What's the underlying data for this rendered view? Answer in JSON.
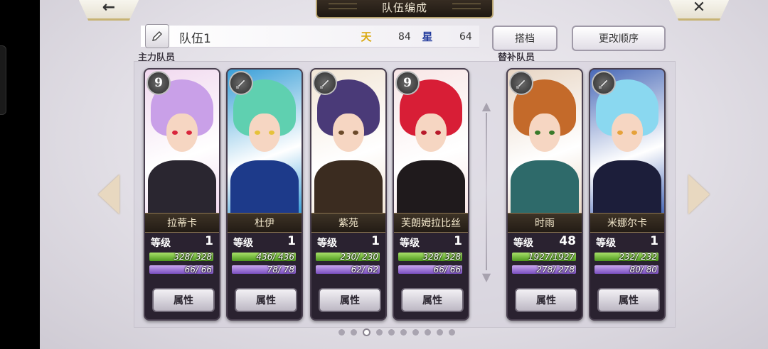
{
  "header": {
    "back_icon": "←",
    "title": "队伍编成",
    "close_icon": "✕"
  },
  "team": {
    "name": "队伍1",
    "stat1_icon": "天",
    "stat1_value": "84",
    "stat2_icon": "星",
    "stat2_value": "64"
  },
  "buttons": {
    "partner": "搭档",
    "reorder": "更改顺序"
  },
  "sections": {
    "main": "主力队员",
    "sub": "替补队员"
  },
  "labels": {
    "level": "等级",
    "attr": "属性"
  },
  "members": [
    {
      "name": "拉蒂卡",
      "badge": "9",
      "level": "1",
      "hp": "328/ 328",
      "mp": "66/ 66",
      "colors": {
        "bg": "#f1d9ef",
        "hair": "#c9a0e8",
        "body": "#2a2630",
        "eye": "#d9263c"
      }
    },
    {
      "name": "杜伊",
      "badge": "",
      "level": "1",
      "hp": "436/ 436",
      "mp": "78/ 78",
      "colors": {
        "bg": "#3a9fd8",
        "hair": "#5fd0b0",
        "body": "#1d3a8a",
        "eye": "#e6c23a"
      }
    },
    {
      "name": "紫苑",
      "badge": "",
      "level": "1",
      "hp": "230/ 230",
      "mp": "62/ 62",
      "colors": {
        "bg": "#f2e6d6",
        "hair": "#4a3a78",
        "body": "#3b2c20",
        "eye": "#6b4a2a"
      }
    },
    {
      "name": "芙朗姆拉比丝",
      "badge": "9",
      "level": "1",
      "hp": "328/ 328",
      "mp": "66/ 66",
      "colors": {
        "bg": "#f8e6e6",
        "hair": "#d81e36",
        "body": "#1f1a1c",
        "eye": "#b81a2a"
      }
    }
  ],
  "substitutes": [
    {
      "name": "时雨",
      "badge": "",
      "level": "48",
      "hp": "1927/1927",
      "mp": "278/ 278",
      "colors": {
        "bg": "#e8d6c4",
        "hair": "#c46a2a",
        "body": "#2e6a6a",
        "eye": "#3a7a2a"
      }
    },
    {
      "name": "米娜尔卡",
      "badge": "",
      "level": "1",
      "hp": "232/ 232",
      "mp": "80/ 80",
      "colors": {
        "bg": "#4a6ab8",
        "hair": "#8ad8f0",
        "body": "#1c1e3a",
        "eye": "#e6a23a"
      }
    }
  ],
  "pagination": {
    "total": 10,
    "current": 3
  }
}
